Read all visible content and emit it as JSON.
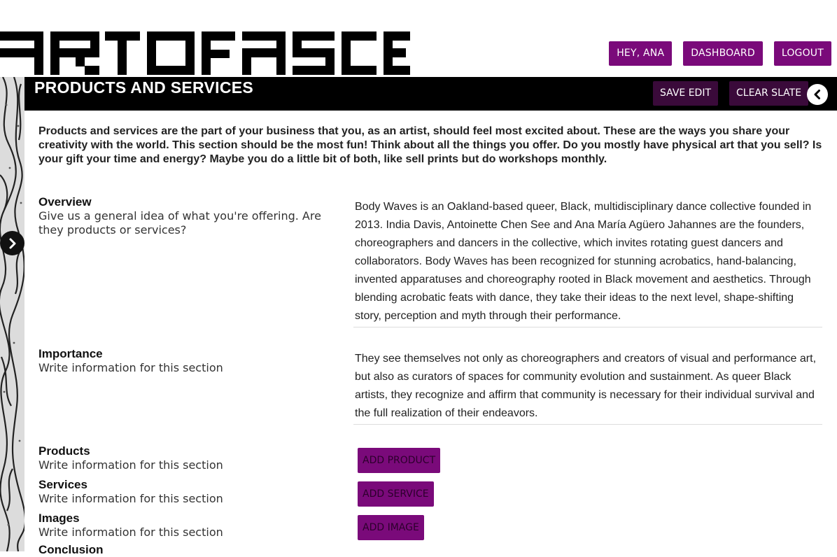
{
  "brand": {
    "logo_text": "ART OF ASCENT",
    "accent": "#7a0a7a"
  },
  "topnav": {
    "greeting": "HEY, ANA",
    "dashboard": "DASHBOARD",
    "logout": "LOGOUT"
  },
  "header": {
    "title": "PRODUCTS AND SERVICES",
    "save_edit": "SAVE EDIT",
    "clear_slate": "CLEAR SLATE"
  },
  "icons": {
    "sidebar_toggle": "chevron-right-icon",
    "back": "chevron-left-icon"
  },
  "intro": "Products and services are the part of your business that you, as an artist, should feel most excited about. These are the ways you share your creativity with the world. This section should be the most fun! Think about all the things you offer. Do you mostly have physical art that you sell? Is your gift your time and energy? Maybe you do a little bit of both, like sell prints but do workshops monthly.",
  "sections": {
    "overview": {
      "heading": "Overview",
      "hint": "Give us a general idea of what you're offering. Are they products or services?",
      "answer": "Body Waves is an Oakland-based queer, Black, multidisciplinary dance collective founded in 2013. India Davis, Antoinette Chen See and Ana María Agüero Jahannes are the  founders, choreographers and dancers in the collective, which invites rotating guest dancers and collaborators. Body Waves has been recognized for stunning acrobatics, hand-balancing, invented apparatuses and choreography rooted in Black movement and aesthetics. Through blending acrobatic feats with dance, they take their ideas to the next level, shape-shifting story, perception and myth through their performance."
    },
    "importance": {
      "heading": "Importance",
      "hint": "Write information for this section",
      "answer": "They see themselves not only as choreographers and creators of visual and performance art, but also as curators of spaces for community evolution and sustainment. As queer Black artists, they recognize and affirm that community is necessary for their individual survival and the full realization of their endeavors."
    },
    "products": {
      "heading": "Products",
      "hint": "Write information for this section",
      "button": "ADD PRODUCT"
    },
    "services": {
      "heading": "Services",
      "hint": "Write information for this section",
      "button": "ADD SERVICE"
    },
    "images": {
      "heading": "Images",
      "hint": "Write information for this section",
      "button": "ADD IMAGE"
    },
    "conclusion": {
      "heading": "Conclusion"
    }
  }
}
